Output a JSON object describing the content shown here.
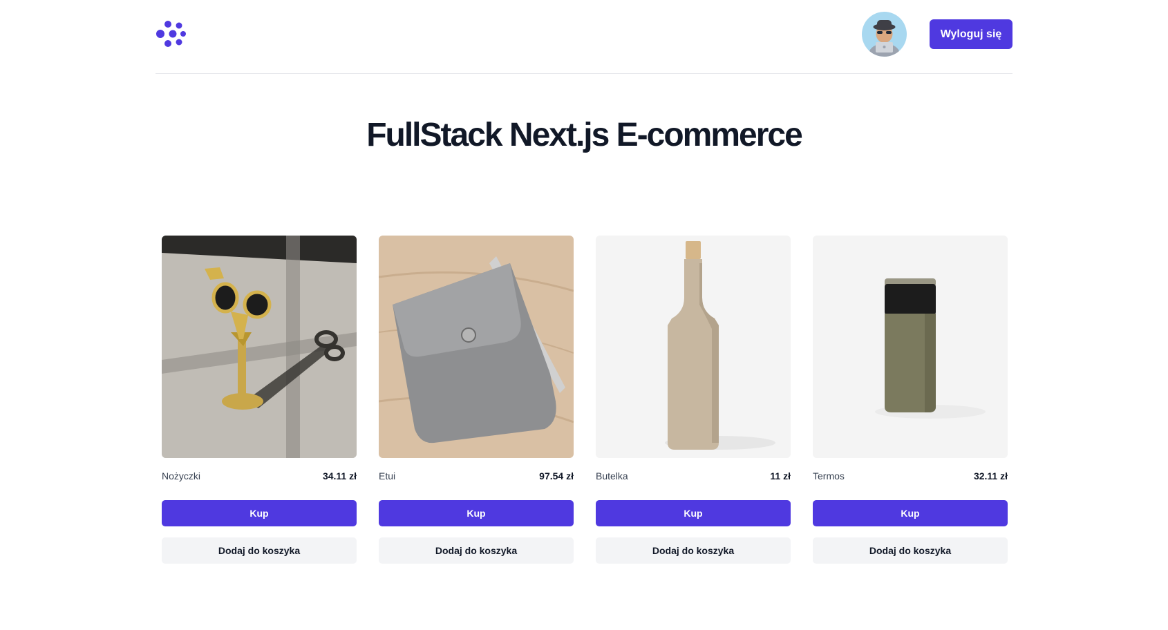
{
  "header": {
    "logo_icon": "brand-logo-icon",
    "avatar_icon": "user-avatar",
    "logout_label": "Wyloguj się",
    "accent_color": "#4f39e0"
  },
  "main": {
    "title": "FullStack Next.js E-commerce"
  },
  "products": [
    {
      "name": "Nożyczki",
      "price": "34.11 zł",
      "image_icon": "scissors-image",
      "buy_label": "Kup",
      "cart_label": "Dodaj do koszyka"
    },
    {
      "name": "Etui",
      "price": "97.54 zł",
      "image_icon": "felt-pouch-image",
      "buy_label": "Kup",
      "cart_label": "Dodaj do koszyka"
    },
    {
      "name": "Butelka",
      "price": "11 zł",
      "image_icon": "bottle-image",
      "buy_label": "Kup",
      "cart_label": "Dodaj do koszyka"
    },
    {
      "name": "Termos",
      "price": "32.11 zł",
      "image_icon": "thermos-image",
      "buy_label": "Kup",
      "cart_label": "Dodaj do koszyka"
    }
  ]
}
